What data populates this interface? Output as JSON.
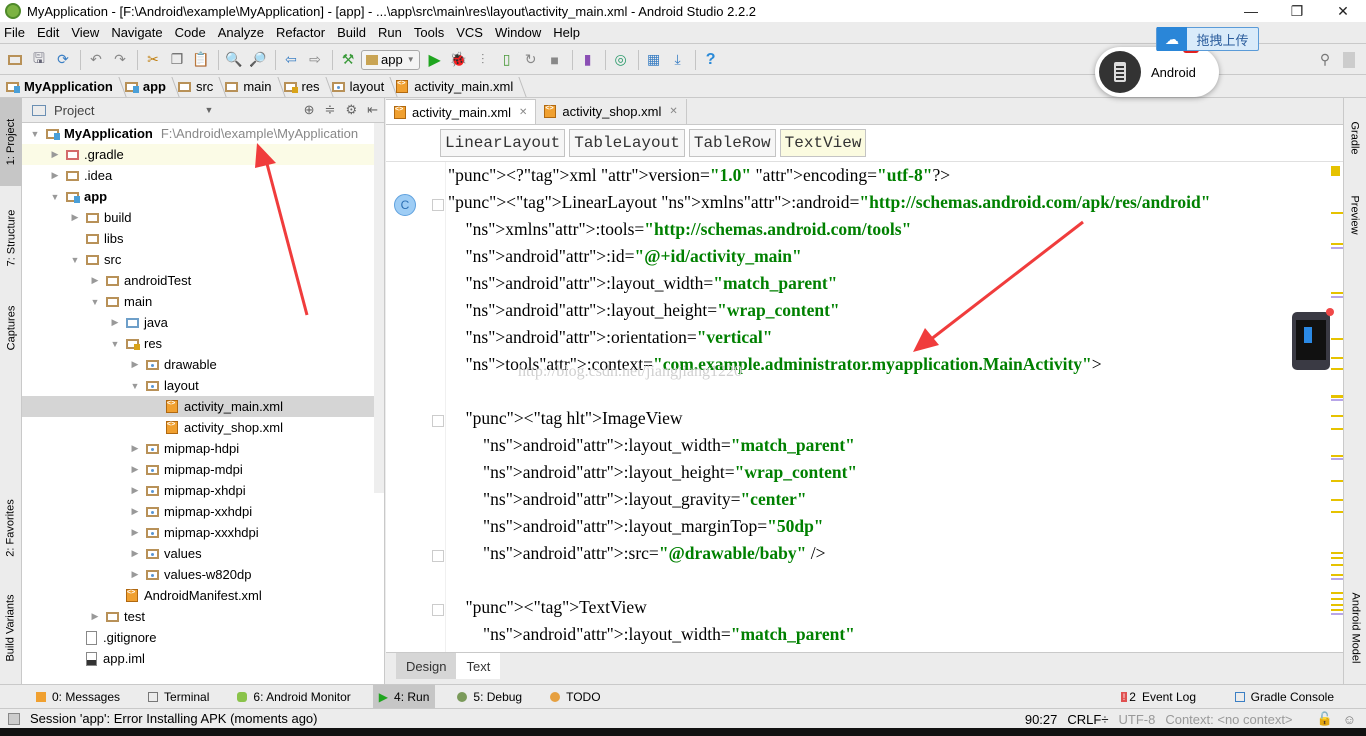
{
  "window": {
    "title": "MyApplication - [F:\\Android\\example\\MyApplication] - [app] - ...\\app\\src\\main\\res\\layout\\activity_main.xml - Android Studio 2.2.2",
    "minimize": "—",
    "maximize": "❐",
    "close": "✕"
  },
  "menu": [
    "File",
    "Edit",
    "View",
    "Navigate",
    "Code",
    "Analyze",
    "Refactor",
    "Build",
    "Run",
    "Tools",
    "VCS",
    "Window",
    "Help"
  ],
  "toolbar": {
    "run_config": "app",
    "help": "?",
    "search": "⚲"
  },
  "breadcrumb": [
    "MyApplication",
    "app",
    "src",
    "main",
    "res",
    "layout",
    "activity_main.xml"
  ],
  "left_tools": [
    "1: Project",
    "7: Structure",
    "Captures",
    "2: Favorites",
    "Build Variants"
  ],
  "project_panel": {
    "title": "Project",
    "tree": [
      {
        "label": "MyApplication",
        "path": "F:\\Android\\example\\MyApplication",
        "depth": 0,
        "arrow": "▼",
        "icon": "module-folder",
        "bold": true
      },
      {
        "label": ".gradle",
        "depth": 1,
        "arrow": "▶",
        "icon": "folder-red"
      },
      {
        "label": ".idea",
        "depth": 1,
        "arrow": "▶",
        "icon": "folder"
      },
      {
        "label": "app",
        "depth": 1,
        "arrow": "▼",
        "icon": "module-folder",
        "bold": true
      },
      {
        "label": "build",
        "depth": 2,
        "arrow": "▶",
        "icon": "folder"
      },
      {
        "label": "libs",
        "depth": 2,
        "arrow": "",
        "icon": "folder"
      },
      {
        "label": "src",
        "depth": 2,
        "arrow": "▼",
        "icon": "folder"
      },
      {
        "label": "androidTest",
        "depth": 3,
        "arrow": "▶",
        "icon": "folder"
      },
      {
        "label": "main",
        "depth": 3,
        "arrow": "▼",
        "icon": "folder"
      },
      {
        "label": "java",
        "depth": 4,
        "arrow": "▶",
        "icon": "folder-blue"
      },
      {
        "label": "res",
        "depth": 4,
        "arrow": "▼",
        "icon": "res-folder"
      },
      {
        "label": "drawable",
        "depth": 5,
        "arrow": "▶",
        "icon": "folder-dot"
      },
      {
        "label": "layout",
        "depth": 5,
        "arrow": "▼",
        "icon": "folder-dot"
      },
      {
        "label": "activity_main.xml",
        "depth": 6,
        "arrow": "",
        "icon": "xml-file",
        "selected": true
      },
      {
        "label": "activity_shop.xml",
        "depth": 6,
        "arrow": "",
        "icon": "xml-file"
      },
      {
        "label": "mipmap-hdpi",
        "depth": 5,
        "arrow": "▶",
        "icon": "folder-dot"
      },
      {
        "label": "mipmap-mdpi",
        "depth": 5,
        "arrow": "▶",
        "icon": "folder-dot"
      },
      {
        "label": "mipmap-xhdpi",
        "depth": 5,
        "arrow": "▶",
        "icon": "folder-dot"
      },
      {
        "label": "mipmap-xxhdpi",
        "depth": 5,
        "arrow": "▶",
        "icon": "folder-dot"
      },
      {
        "label": "mipmap-xxxhdpi",
        "depth": 5,
        "arrow": "▶",
        "icon": "folder-dot"
      },
      {
        "label": "values",
        "depth": 5,
        "arrow": "▶",
        "icon": "folder-dot"
      },
      {
        "label": "values-w820dp",
        "depth": 5,
        "arrow": "▶",
        "icon": "folder-dot"
      },
      {
        "label": "AndroidManifest.xml",
        "depth": 4,
        "arrow": "",
        "icon": "manifest-file"
      },
      {
        "label": "test",
        "depth": 3,
        "arrow": "▶",
        "icon": "folder"
      },
      {
        "label": ".gitignore",
        "depth": 2,
        "arrow": "",
        "icon": "text-file"
      },
      {
        "label": "app.iml",
        "depth": 2,
        "arrow": "",
        "icon": "iml-file"
      }
    ]
  },
  "editor": {
    "tabs": [
      {
        "label": "activity_main.xml",
        "active": true
      },
      {
        "label": "activity_shop.xml",
        "active": false
      }
    ],
    "structure_crumbs": [
      "LinearLayout",
      "TableLayout",
      "TableRow",
      "TextView"
    ],
    "code_lines": [
      "<?xml version=\"1.0\" encoding=\"utf-8\"?>",
      "<LinearLayout xmlns:android=\"http://schemas.android.com/apk/res/android\"",
      "    xmlns:tools=\"http://schemas.android.com/tools\"",
      "    android:id=\"@+id/activity_main\"",
      "    android:layout_width=\"match_parent\"",
      "    android:layout_height=\"wrap_content\"",
      "    android:orientation=\"vertical\"",
      "    tools:context=\"com.example.administrator.myapplication.MainActivity\">",
      "",
      "    <ImageView",
      "        android:layout_width=\"match_parent\"",
      "        android:layout_height=\"wrap_content\"",
      "        android:layout_gravity=\"center\"",
      "        android:layout_marginTop=\"50dp\"",
      "        android:src=\"@drawable/baby\" />",
      "",
      "    <TextView",
      "        android:layout_width=\"match_parent\""
    ],
    "watermark": "http://blog.csdn.net/jiangjiang1220",
    "gutter_badge": "C",
    "bottom_tabs": [
      {
        "label": "Design",
        "active": false
      },
      {
        "label": "Text",
        "active": true
      }
    ]
  },
  "right_tools": [
    "Gradle",
    "Preview",
    "Android Model"
  ],
  "tool_windows": [
    {
      "label": "0: Messages"
    },
    {
      "label": "Terminal"
    },
    {
      "label": "6: Android Monitor"
    },
    {
      "label": "4: Run",
      "active": true
    },
    {
      "label": "5: Debug"
    },
    {
      "label": "TODO"
    }
  ],
  "tool_windows_right": [
    {
      "label": "Event Log",
      "badge": "2"
    },
    {
      "label": "Gradle Console"
    }
  ],
  "status": {
    "message": "Session 'app': Error Installing APK (moments ago)",
    "position": "90:27",
    "line_sep": "CRLF÷",
    "encoding": "UTF-8",
    "context": "Context: <no context>"
  },
  "overlays": {
    "upload_label": "拖拽上传",
    "device_label": "Android"
  },
  "colors": {
    "xml_tag": "#000080",
    "xml_attr": "#0000ff",
    "xml_ns": "#660e7a",
    "xml_value": "#008000",
    "annotation_arrow": "#f03c3c"
  }
}
